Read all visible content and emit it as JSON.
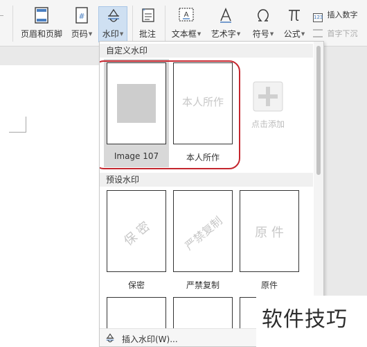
{
  "ribbon": {
    "header_footer": "页眉和页脚",
    "page_number": "页码",
    "watermark": "水印",
    "comment": "批注",
    "text_box": "文本框",
    "word_art": "艺术字",
    "symbol": "符号",
    "formula": "公式",
    "insert_number": "插入数字",
    "drop_cap": "首字下沉"
  },
  "dropdown": {
    "custom_section": "自定义水印",
    "custom_items": [
      {
        "caption": "Image 107"
      },
      {
        "caption": "本人所作",
        "watermark_text": "本人所作"
      }
    ],
    "add_label": "点击添加",
    "preset_section": "预设水印",
    "preset_items": [
      {
        "caption": "保密",
        "watermark_text": "保 密"
      },
      {
        "caption": "严禁复制",
        "watermark_text": "严禁复制"
      },
      {
        "caption": "原件",
        "watermark_text": "原 件"
      }
    ],
    "insert_watermark": "插入水印(W)..."
  },
  "brand_watermark": "软件技巧",
  "colors": {
    "highlight_outline": "#c4262e",
    "active_button": "#cfe0f2",
    "watermark_text": "#c7c7c7"
  }
}
